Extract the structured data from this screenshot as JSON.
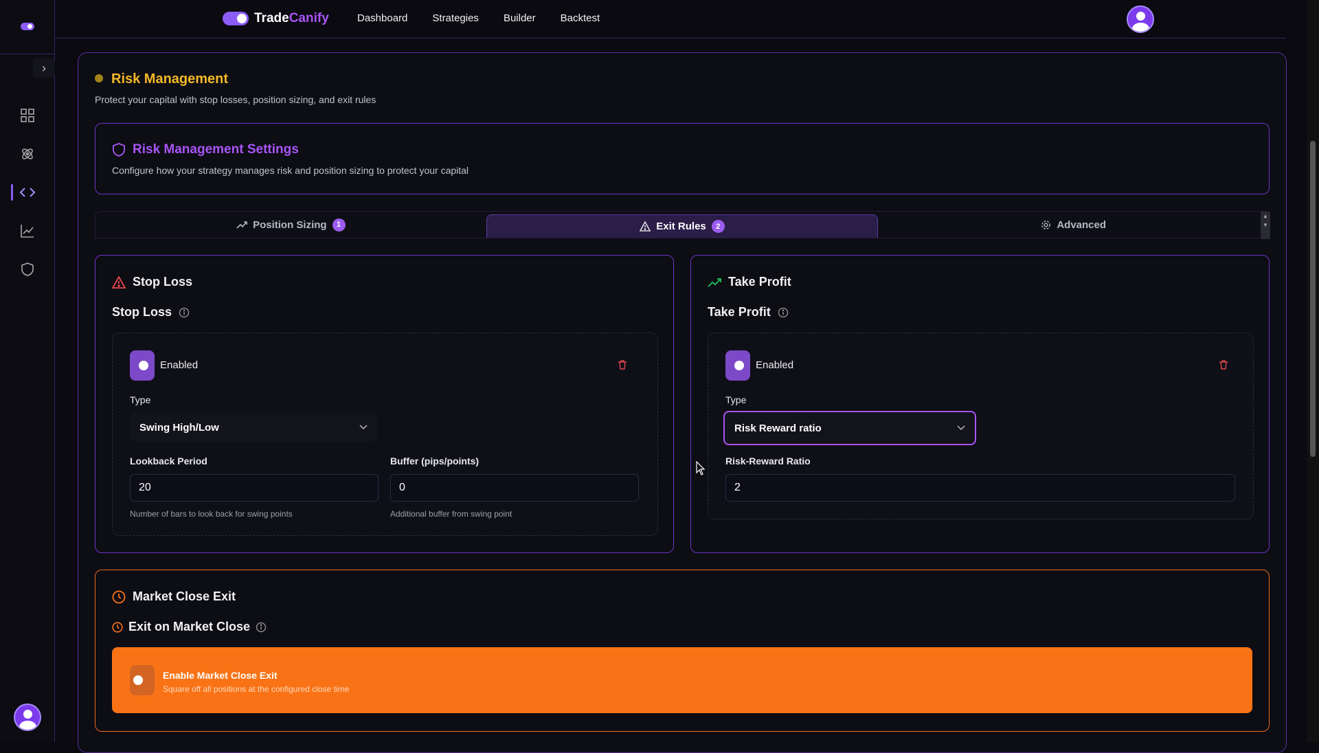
{
  "brand": {
    "part1": "Trade",
    "part2": "Canify"
  },
  "topnav": [
    "Dashboard",
    "Strategies",
    "Builder",
    "Backtest"
  ],
  "section": {
    "title": "Risk Management",
    "subtitle": "Protect your capital with stop losses, position sizing, and exit rules"
  },
  "settings": {
    "title": "Risk Management Settings",
    "description": "Configure how your strategy manages risk and position sizing to protect your capital"
  },
  "tabs": [
    {
      "label": "Position Sizing",
      "badge": "1"
    },
    {
      "label": "Exit Rules",
      "badge": "2"
    },
    {
      "label": "Advanced",
      "badge": ""
    }
  ],
  "stop_loss": {
    "panel_title": "Stop Loss",
    "label": "Stop Loss",
    "enabled_label": "Enabled",
    "type_label": "Type",
    "type_value": "Swing High/Low",
    "lookback_label": "Lookback Period",
    "lookback_value": "20",
    "lookback_hint": "Number of bars to look back for swing points",
    "buffer_label": "Buffer (pips/points)",
    "buffer_value": "0",
    "buffer_hint": "Additional buffer from swing point"
  },
  "take_profit": {
    "panel_title": "Take Profit",
    "label": "Take Profit",
    "enabled_label": "Enabled",
    "type_label": "Type",
    "type_value": "Risk Reward ratio",
    "ratio_label": "Risk-Reward Ratio",
    "ratio_value": "2"
  },
  "market_close": {
    "panel_title": "Market Close Exit",
    "label": "Exit on Market Close",
    "toggle_title": "Enable Market Close Exit",
    "toggle_sub": "Square off all positions at the configured close time"
  },
  "colors": {
    "accent": "#8b5cf6",
    "heading": "#f5b928",
    "orange": "#f97316",
    "danger": "#e5484d",
    "profit": "#22c55e"
  }
}
